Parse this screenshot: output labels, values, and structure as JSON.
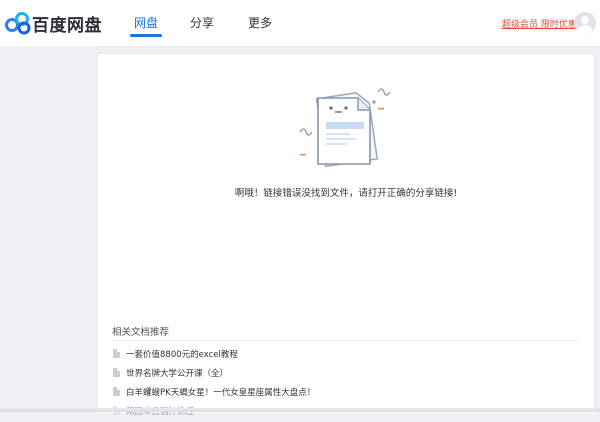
{
  "header": {
    "logo_text": "百度网盘",
    "nav": [
      {
        "label": "网盘",
        "active": true
      },
      {
        "label": "分享",
        "active": false
      },
      {
        "label": "更多",
        "active": false
      }
    ],
    "promo_link": "超级会员 限时优惠"
  },
  "main": {
    "error_message": "啊哦！链接错误没找到文件，请打开正确的分享链接!",
    "related": {
      "title": "相关文档推荐",
      "items": [
        {
          "label": "一套价值8800元的excel教程"
        },
        {
          "label": "世界名牌大学公开课（全）"
        },
        {
          "label": "白羊蠼螋PK天蝎女星！一代女皇星座属性大盘点！"
        },
        {
          "label": "帮团单丘猖狞涂经"
        }
      ]
    }
  },
  "colors": {
    "accent": "#1a73e8",
    "promo": "#e8483e"
  },
  "icons": {
    "logo": "baidu-netdisk-logo",
    "avatar": "user-avatar-icon",
    "document": "document-icon",
    "empty_state": "broken-file-illustration"
  }
}
